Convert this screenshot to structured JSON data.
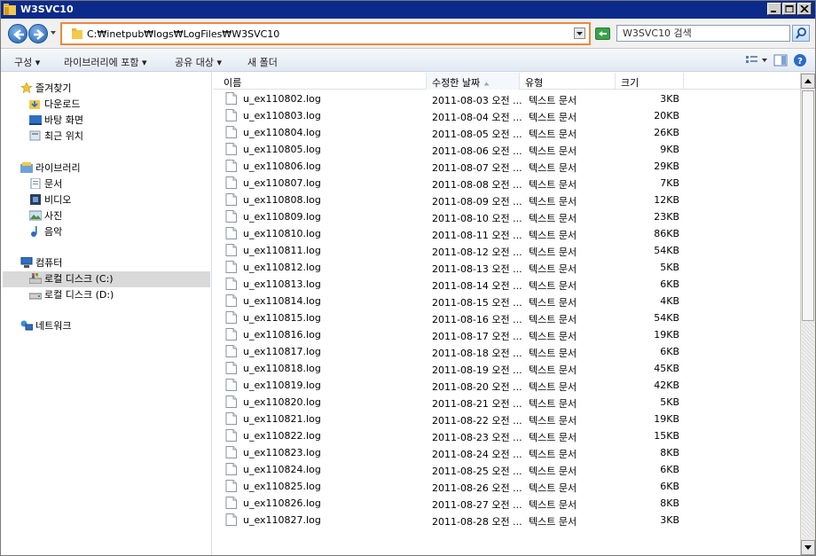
{
  "window": {
    "title": "W3SVC10",
    "buttons": [
      "minimize",
      "maximize",
      "close"
    ]
  },
  "address": {
    "path": "C:₩inetpub₩logs₩LogFiles₩W3SVC10",
    "search_placeholder": "W3SVC10 검색"
  },
  "toolbar": {
    "organize": "구성 ▾",
    "include_library": "라이브러리에 포함 ▾",
    "share": "공유 대상 ▾",
    "new_folder": "새 폴더"
  },
  "nav": {
    "favorites": "즐겨찾기",
    "downloads": "다운로드",
    "desktop": "바탕 화면",
    "recent": "최근 위치",
    "libraries": "라이브러리",
    "documents": "문서",
    "videos": "비디오",
    "pictures": "사진",
    "music": "음악",
    "computer": "컴퓨터",
    "local_c": "로컬 디스크 (C:)",
    "local_d": "로컬 디스크 (D:)",
    "network": "네트워크"
  },
  "columns": {
    "name": "이름",
    "date": "수정한 날짜",
    "type": "유형",
    "size": "크기"
  },
  "files": [
    {
      "name": "u_ex110802.log",
      "date": "2011-08-03 오전 ...",
      "type": "텍스트 문서",
      "size": "3KB"
    },
    {
      "name": "u_ex110803.log",
      "date": "2011-08-04 오전 ...",
      "type": "텍스트 문서",
      "size": "20KB"
    },
    {
      "name": "u_ex110804.log",
      "date": "2011-08-05 오전 ...",
      "type": "텍스트 문서",
      "size": "26KB"
    },
    {
      "name": "u_ex110805.log",
      "date": "2011-08-06 오전 ...",
      "type": "텍스트 문서",
      "size": "9KB"
    },
    {
      "name": "u_ex110806.log",
      "date": "2011-08-07 오전 ...",
      "type": "텍스트 문서",
      "size": "29KB"
    },
    {
      "name": "u_ex110807.log",
      "date": "2011-08-08 오전 ...",
      "type": "텍스트 문서",
      "size": "7KB"
    },
    {
      "name": "u_ex110808.log",
      "date": "2011-08-09 오전 ...",
      "type": "텍스트 문서",
      "size": "12KB"
    },
    {
      "name": "u_ex110809.log",
      "date": "2011-08-10 오전 ...",
      "type": "텍스트 문서",
      "size": "23KB"
    },
    {
      "name": "u_ex110810.log",
      "date": "2011-08-11 오전 ...",
      "type": "텍스트 문서",
      "size": "86KB"
    },
    {
      "name": "u_ex110811.log",
      "date": "2011-08-12 오전 ...",
      "type": "텍스트 문서",
      "size": "54KB"
    },
    {
      "name": "u_ex110812.log",
      "date": "2011-08-13 오전 ...",
      "type": "텍스트 문서",
      "size": "5KB"
    },
    {
      "name": "u_ex110813.log",
      "date": "2011-08-14 오전 ...",
      "type": "텍스트 문서",
      "size": "6KB"
    },
    {
      "name": "u_ex110814.log",
      "date": "2011-08-15 오전 ...",
      "type": "텍스트 문서",
      "size": "4KB"
    },
    {
      "name": "u_ex110815.log",
      "date": "2011-08-16 오전 ...",
      "type": "텍스트 문서",
      "size": "54KB"
    },
    {
      "name": "u_ex110816.log",
      "date": "2011-08-17 오전 ...",
      "type": "텍스트 문서",
      "size": "19KB"
    },
    {
      "name": "u_ex110817.log",
      "date": "2011-08-18 오전 ...",
      "type": "텍스트 문서",
      "size": "6KB"
    },
    {
      "name": "u_ex110818.log",
      "date": "2011-08-19 오전 ...",
      "type": "텍스트 문서",
      "size": "45KB"
    },
    {
      "name": "u_ex110819.log",
      "date": "2011-08-20 오전 ...",
      "type": "텍스트 문서",
      "size": "42KB"
    },
    {
      "name": "u_ex110820.log",
      "date": "2011-08-21 오전 ...",
      "type": "텍스트 문서",
      "size": "5KB"
    },
    {
      "name": "u_ex110821.log",
      "date": "2011-08-22 오전 ...",
      "type": "텍스트 문서",
      "size": "19KB"
    },
    {
      "name": "u_ex110822.log",
      "date": "2011-08-23 오전 ...",
      "type": "텍스트 문서",
      "size": "15KB"
    },
    {
      "name": "u_ex110823.log",
      "date": "2011-08-24 오전 ...",
      "type": "텍스트 문서",
      "size": "8KB"
    },
    {
      "name": "u_ex110824.log",
      "date": "2011-08-25 오전 ...",
      "type": "텍스트 문서",
      "size": "6KB"
    },
    {
      "name": "u_ex110825.log",
      "date": "2011-08-26 오전 ...",
      "type": "텍스트 문서",
      "size": "6KB"
    },
    {
      "name": "u_ex110826.log",
      "date": "2011-08-27 오전 ...",
      "type": "텍스트 문서",
      "size": "8KB"
    },
    {
      "name": "u_ex110827.log",
      "date": "2011-08-28 오전 ...",
      "type": "텍스트 문서",
      "size": "3KB"
    }
  ],
  "colors": {
    "titlebar": "#0b2a8a",
    "address_highlight": "#ec8a3a",
    "selected_nav": "#d9d9d9"
  }
}
